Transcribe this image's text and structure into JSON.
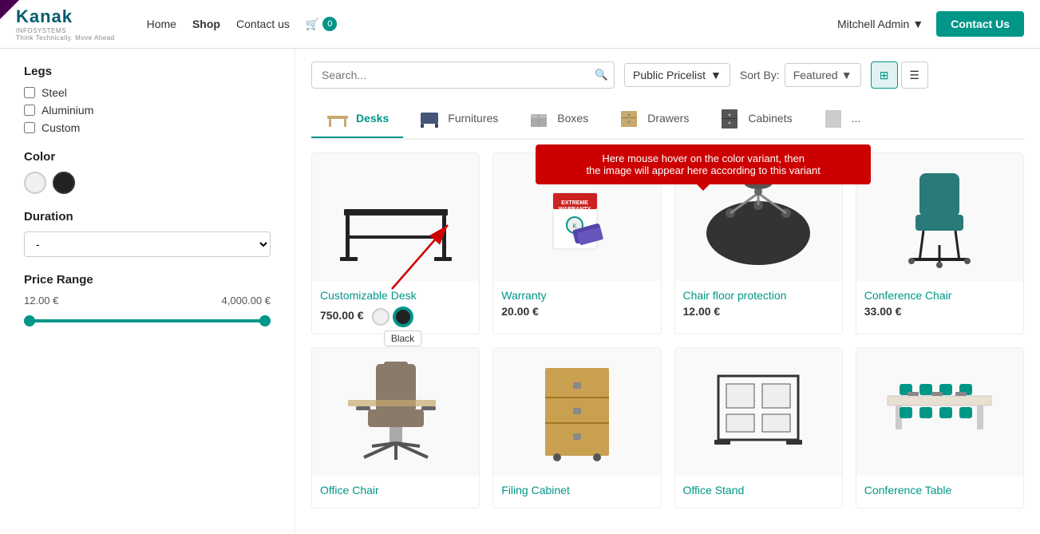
{
  "header": {
    "logo_name": "Kanak",
    "logo_sub": "INFOSYSTEMS",
    "logo_tagline": "Think Technically. Move Ahead",
    "nav": [
      {
        "label": "Home",
        "active": false
      },
      {
        "label": "Shop",
        "active": true
      },
      {
        "label": "Contact us",
        "active": false
      }
    ],
    "cart_count": "0",
    "user_name": "Mitchell Admin",
    "contact_us_label": "Contact Us"
  },
  "search": {
    "placeholder": "Search...",
    "pricelist": "Public Pricelist",
    "sort_by_label": "Sort By:",
    "sort_value": "Featured",
    "view_grid_title": "Grid View",
    "view_list_title": "List View"
  },
  "categories": [
    {
      "label": "Desks",
      "icon": "desk"
    },
    {
      "label": "Furnitures",
      "icon": "furniture"
    },
    {
      "label": "Boxes",
      "icon": "box"
    },
    {
      "label": "Drawers",
      "icon": "drawer"
    },
    {
      "label": "Cabinets",
      "icon": "cabinet"
    },
    {
      "label": "...",
      "icon": "more"
    }
  ],
  "sidebar": {
    "legs_title": "Legs",
    "legs_options": [
      {
        "label": "Steel",
        "checked": false
      },
      {
        "label": "Aluminium",
        "checked": false
      },
      {
        "label": "Custom",
        "checked": false
      }
    ],
    "color_title": "Color",
    "colors": [
      {
        "name": "white",
        "label": "White"
      },
      {
        "name": "black",
        "label": "Black"
      }
    ],
    "duration_title": "Duration",
    "duration_placeholder": "-",
    "price_range_title": "Price Range",
    "price_min": "12.00 €",
    "price_max": "4,000.00 €"
  },
  "products_row1": [
    {
      "name": "Customizable Desk",
      "price": "750.00 €",
      "has_variants": true,
      "variants": [
        "white",
        "black"
      ]
    },
    {
      "name": "Warranty",
      "price": "20.00 €",
      "has_variants": false,
      "variants": []
    },
    {
      "name": "Chair floor protection",
      "price": "12.00 €",
      "has_variants": false,
      "variants": []
    },
    {
      "name": "Conference Chair",
      "price": "33.00 €",
      "has_variants": false,
      "variants": []
    }
  ],
  "products_row2": [
    {
      "name": "Office Chair",
      "price": ""
    },
    {
      "name": "Filing Cabinet",
      "price": ""
    },
    {
      "name": "Office Stand",
      "price": ""
    },
    {
      "name": "Conference Table",
      "price": ""
    }
  ],
  "tooltip": {
    "hover_text_line1": "Here mouse hover on the color variant, then",
    "hover_text_line2": "the image will appear here according to this variant"
  },
  "black_tooltip": "Black",
  "colors_accent": "#009688"
}
